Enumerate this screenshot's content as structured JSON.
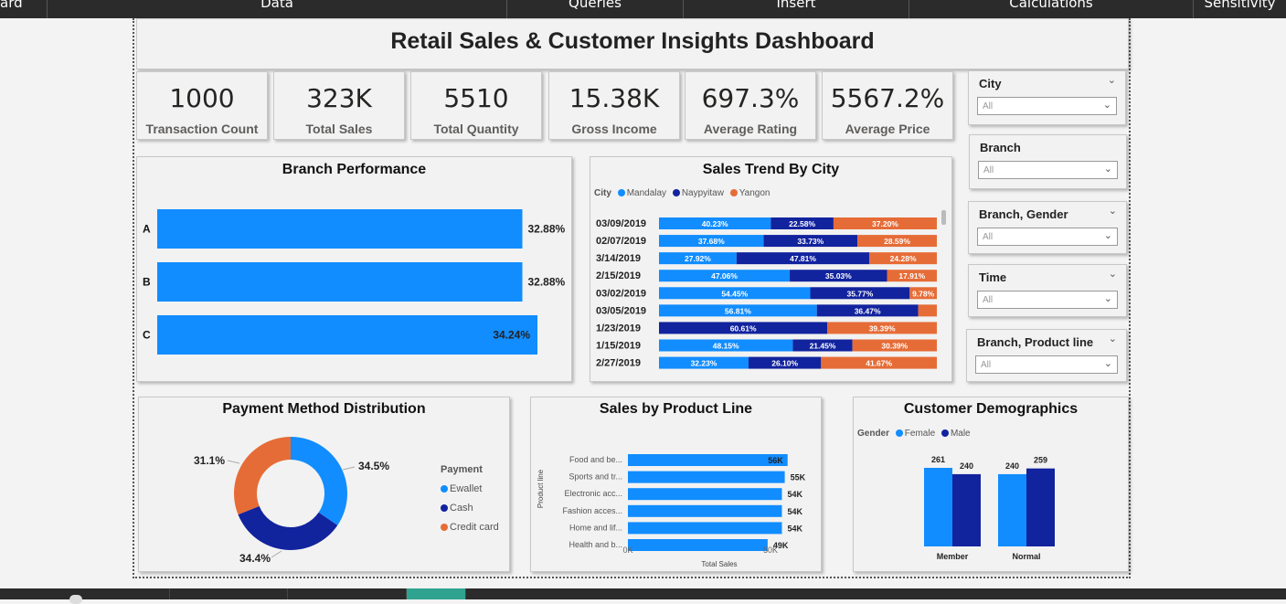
{
  "ribbon": {
    "tabs": [
      "ard",
      "Data",
      "Queries",
      "Insert",
      "Calculations",
      "Sensitivity"
    ]
  },
  "dashboard": {
    "title": "Retail Sales & Customer Insights Dashboard"
  },
  "kpis": [
    {
      "value": "1000",
      "label": "Transaction Count"
    },
    {
      "value": "323K",
      "label": "Total Sales"
    },
    {
      "value": "5510",
      "label": "Total Quantity"
    },
    {
      "value": "15.38K",
      "label": "Gross Income"
    },
    {
      "value": "697.3%",
      "label": "Average Rating"
    },
    {
      "value": "5567.2%",
      "label": "Average Price"
    }
  ],
  "slicers": [
    {
      "label": "City",
      "value": "All"
    },
    {
      "label": "Branch",
      "value": "All"
    },
    {
      "label": "Branch, Gender",
      "value": "All"
    },
    {
      "label": "Time",
      "value": "All"
    },
    {
      "label": "Branch, Product line",
      "value": "All"
    }
  ],
  "colors": {
    "accent": "#118dff",
    "navy": "#12239e",
    "orange": "#e66c37",
    "topbar": "#2b2b2b",
    "active_tab": "#2fa38f"
  },
  "branch_title": "Branch Performance",
  "trend_title": "Sales Trend By City",
  "trend_legend": {
    "title": "City",
    "items": [
      "Mandalay",
      "Naypyitaw",
      "Yangon"
    ]
  },
  "payment_title": "Payment Method Distribution",
  "payment_legend": {
    "title": "Payment",
    "items": [
      "Ewallet",
      "Cash",
      "Credit card"
    ]
  },
  "product_title": "Sales by Product Line",
  "demo_title": "Customer Demographics",
  "demo_legend": {
    "title": "Gender",
    "items": [
      "Female",
      "Male"
    ]
  },
  "chart_data": [
    {
      "type": "bar",
      "orientation": "horizontal",
      "title": "Branch Performance",
      "categories": [
        "A",
        "B",
        "C"
      ],
      "values": [
        32.88,
        32.88,
        34.24
      ],
      "labels": [
        "32.88%",
        "32.88%",
        "34.24%"
      ],
      "xlim": [
        0,
        40
      ]
    },
    {
      "type": "bar",
      "orientation": "horizontal",
      "stacking": "100%",
      "title": "Sales Trend By City",
      "legend_title": "City",
      "legend_position": "top-left",
      "categories": [
        "03/09/2019",
        "02/07/2019",
        "3/14/2019",
        "2/15/2019",
        "03/02/2019",
        "03/05/2019",
        "1/23/2019",
        "1/15/2019",
        "2/27/2019"
      ],
      "series": [
        {
          "name": "Mandalay",
          "values": [
            40.23,
            37.68,
            27.92,
            47.06,
            54.45,
            56.81,
            0,
            48.15,
            32.23
          ],
          "labels": [
            "40.23%",
            "37.68%",
            "27.92%",
            "47.06%",
            "54.45%",
            "56.81%",
            "",
            "48.15%",
            "32.23%"
          ]
        },
        {
          "name": "Naypyitaw",
          "values": [
            22.58,
            33.73,
            47.81,
            35.03,
            35.77,
            36.47,
            60.61,
            21.45,
            26.1
          ],
          "labels": [
            "22.58%",
            "33.73%",
            "47.81%",
            "35.03%",
            "35.77%",
            "36.47%",
            "60.61%",
            "21.45%",
            "26.10%"
          ]
        },
        {
          "name": "Yangon",
          "values": [
            37.2,
            28.59,
            24.28,
            17.91,
            9.78,
            6.72,
            39.39,
            30.39,
            41.67
          ],
          "labels": [
            "37.20%",
            "28.59%",
            "24.28%",
            "17.91%",
            "9.78%",
            "",
            "39.39%",
            "30.39%",
            "41.67%"
          ]
        }
      ]
    },
    {
      "type": "pie",
      "donut": true,
      "title": "Payment Method Distribution",
      "legend_title": "Payment",
      "legend_position": "right",
      "categories": [
        "Ewallet",
        "Cash",
        "Credit card"
      ],
      "values": [
        34.5,
        34.4,
        31.1
      ],
      "labels": [
        "34.5%",
        "34.4%",
        "31.1%"
      ]
    },
    {
      "type": "bar",
      "orientation": "horizontal",
      "title": "Sales by Product Line",
      "xlabel": "Total Sales",
      "ylabel": "Product line",
      "categories": [
        "Food and be...",
        "Sports and tr...",
        "Electronic acc...",
        "Fashion acces...",
        "Home and lif...",
        "Health and b..."
      ],
      "values": [
        56,
        55,
        54,
        54,
        54,
        49
      ],
      "labels": [
        "56K",
        "55K",
        "54K",
        "54K",
        "54K",
        "49K"
      ],
      "xticks": [
        "0K",
        "50K"
      ],
      "xlim": [
        0,
        60
      ]
    },
    {
      "type": "bar",
      "orientation": "vertical",
      "title": "Customer Demographics",
      "legend_title": "Gender",
      "legend_position": "top-left",
      "categories": [
        "Member",
        "Normal"
      ],
      "series": [
        {
          "name": "Female",
          "values": [
            261,
            240
          ]
        },
        {
          "name": "Male",
          "values": [
            240,
            259
          ]
        }
      ],
      "ylim": [
        0,
        280
      ]
    }
  ]
}
